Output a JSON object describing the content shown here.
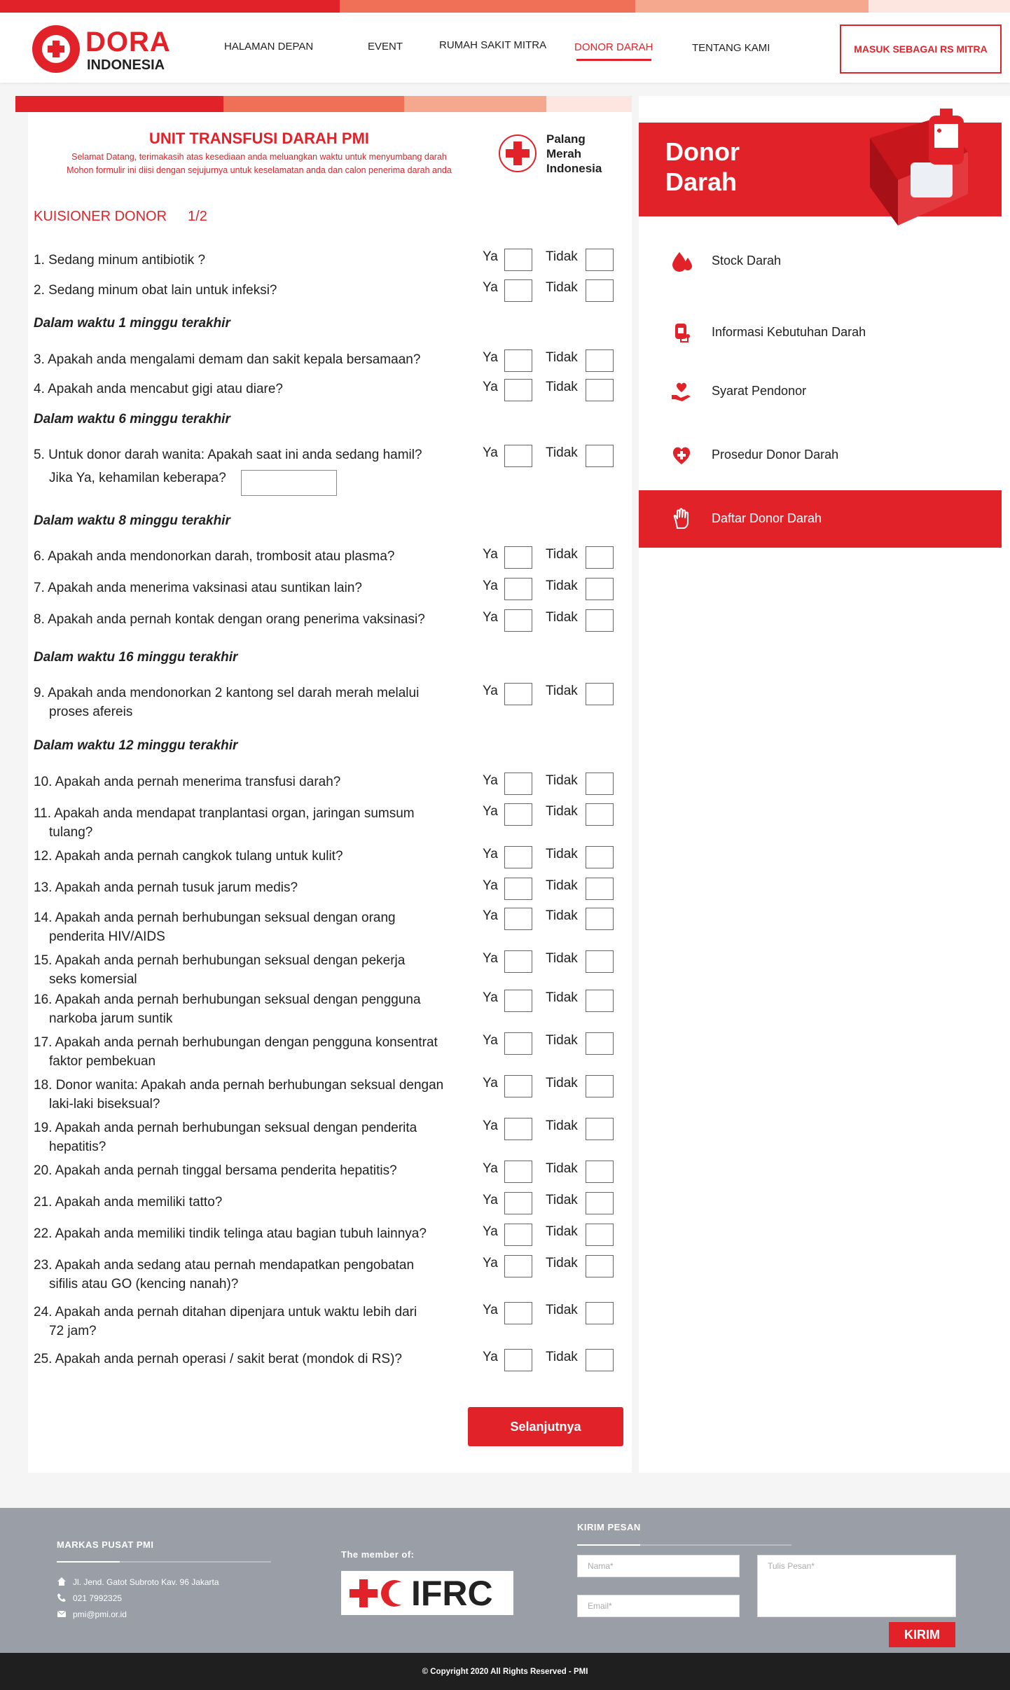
{
  "colors": {
    "red": "#e12229",
    "stripe": [
      "#e12229",
      "#f07057",
      "#f6a88f",
      "#fde6df"
    ]
  },
  "brand": {
    "name": "DORA",
    "sub": "INDONESIA"
  },
  "nav": {
    "items": [
      "HALAMAN DEPAN",
      "EVENT",
      "RUMAH SAKIT MITRA",
      "DONOR DARAH",
      "TENTANG KAMI"
    ],
    "active": "DONOR DARAH",
    "login": "MASUK SEBAGAI RS MITRA"
  },
  "form": {
    "title": "UNIT TRANSFUSI DARAH PMI",
    "subtitle1": "Selamat Datang, terimakasih atas kesediaan anda meluangkan waktu untuk menyumbang darah",
    "subtitle2": "Mohon formulir ini diisi dengan sejujurnya untuk keselamatan anda dan calon penerima darah anda",
    "pmi_logo": "Palang\nMerah\nIndonesia",
    "kuisioner": "KUISIONER DONOR",
    "page": "1/2",
    "yes": "Ya",
    "no": "Tidak",
    "sections": [
      "Dalam waktu 1 minggu terakhir",
      "Dalam waktu 6 minggu terakhir",
      "Dalam waktu 8 minggu terakhir",
      "Dalam waktu 16 minggu terakhir",
      "Dalam waktu 12 minggu terakhir"
    ],
    "questions": [
      {
        "text": "1. Sedang minum antibiotik ?"
      },
      {
        "text": "2. Sedang minum obat lain untuk infeksi?"
      },
      {
        "text": "3. Apakah anda mengalami demam dan sakit kepala bersamaan?"
      },
      {
        "text": "4. Apakah anda mencabut gigi atau diare?"
      },
      {
        "text": "5. Untuk donor darah wanita: Apakah saat ini anda sedang hamil?"
      },
      {
        "text": "6. Apakah anda mendonorkan darah, trombosit atau plasma?"
      },
      {
        "text": "7. Apakah anda menerima vaksinasi atau suntikan lain?"
      },
      {
        "text": "8. Apakah anda pernah kontak dengan orang penerima vaksinasi?"
      },
      {
        "text": "9. Apakah anda mendonorkan 2 kantong sel darah merah melalui",
        "cont": "proses afereis"
      },
      {
        "text": "10. Apakah anda pernah menerima transfusi darah?"
      },
      {
        "text": "11. Apakah anda mendapat tranplantasi organ, jaringan sumsum",
        "cont": "tulang?"
      },
      {
        "text": "12. Apakah anda pernah cangkok tulang untuk kulit?"
      },
      {
        "text": "13. Apakah anda pernah tusuk jarum medis?"
      },
      {
        "text": "14. Apakah anda pernah berhubungan seksual dengan orang",
        "cont": "penderita HIV/AIDS"
      },
      {
        "text": "15. Apakah anda pernah berhubungan seksual dengan pekerja",
        "cont": "seks komersial"
      },
      {
        "text": "16. Apakah anda pernah berhubungan seksual dengan pengguna",
        "cont": "narkoba jarum suntik"
      },
      {
        "text": "17. Apakah anda pernah berhubungan dengan pengguna konsentrat",
        "cont": "faktor pembekuan"
      },
      {
        "text": "18. Donor wanita: Apakah anda pernah berhubungan seksual dengan",
        "cont": "laki-laki biseksual?"
      },
      {
        "text": "19. Apakah anda pernah berhubungan seksual dengan penderita",
        "cont": "hepatitis?"
      },
      {
        "text": "20. Apakah anda pernah tinggal bersama penderita hepatitis?"
      },
      {
        "text": "21. Apakah anda memiliki tatto?"
      },
      {
        "text": "22. Apakah anda memiliki tindik telinga atau bagian tubuh lainnya?"
      },
      {
        "text": "23. Apakah anda sedang atau pernah mendapatkan pengobatan",
        "cont": "sifilis atau GO (kencing nanah)?"
      },
      {
        "text": "24. Apakah anda pernah ditahan dipenjara untuk waktu lebih dari",
        "cont": "72 jam?"
      },
      {
        "text": "25. Apakah anda pernah operasi / sakit berat (mondok di RS)?"
      }
    ],
    "hamil_label": "Jika Ya, kehamilan keberapa?",
    "next": "Selanjutnya"
  },
  "sidebar": {
    "title": "Donor\nDarah",
    "items": [
      {
        "label": "Stock Darah",
        "icon": "blood-drops-icon"
      },
      {
        "label": "Informasi Kebutuhan Darah",
        "icon": "blood-bag-icon"
      },
      {
        "label": "Syarat Pendonor",
        "icon": "heart-hand-icon"
      },
      {
        "label": "Prosedur Donor Darah",
        "icon": "heart-cross-icon"
      },
      {
        "label": "Daftar Donor Darah",
        "icon": "raised-hand-icon",
        "active": true
      }
    ]
  },
  "footer": {
    "hq_title": "MARKAS PUSAT PMI",
    "address": "Jl. Jend. Gatot Subroto Kav. 96 Jakarta",
    "phone": "021 7992325",
    "email": "pmi@pmi.or.id",
    "member": "The member of:",
    "ifrc": "IFRC",
    "msg_title": "KIRIM PESAN",
    "name_ph": "Nama*",
    "email_ph": "Email*",
    "msg_ph": "Tulis Pesan*",
    "send": "KIRIM",
    "copyright": "© Copyright 2020 All Rights Reserved - PMI"
  }
}
